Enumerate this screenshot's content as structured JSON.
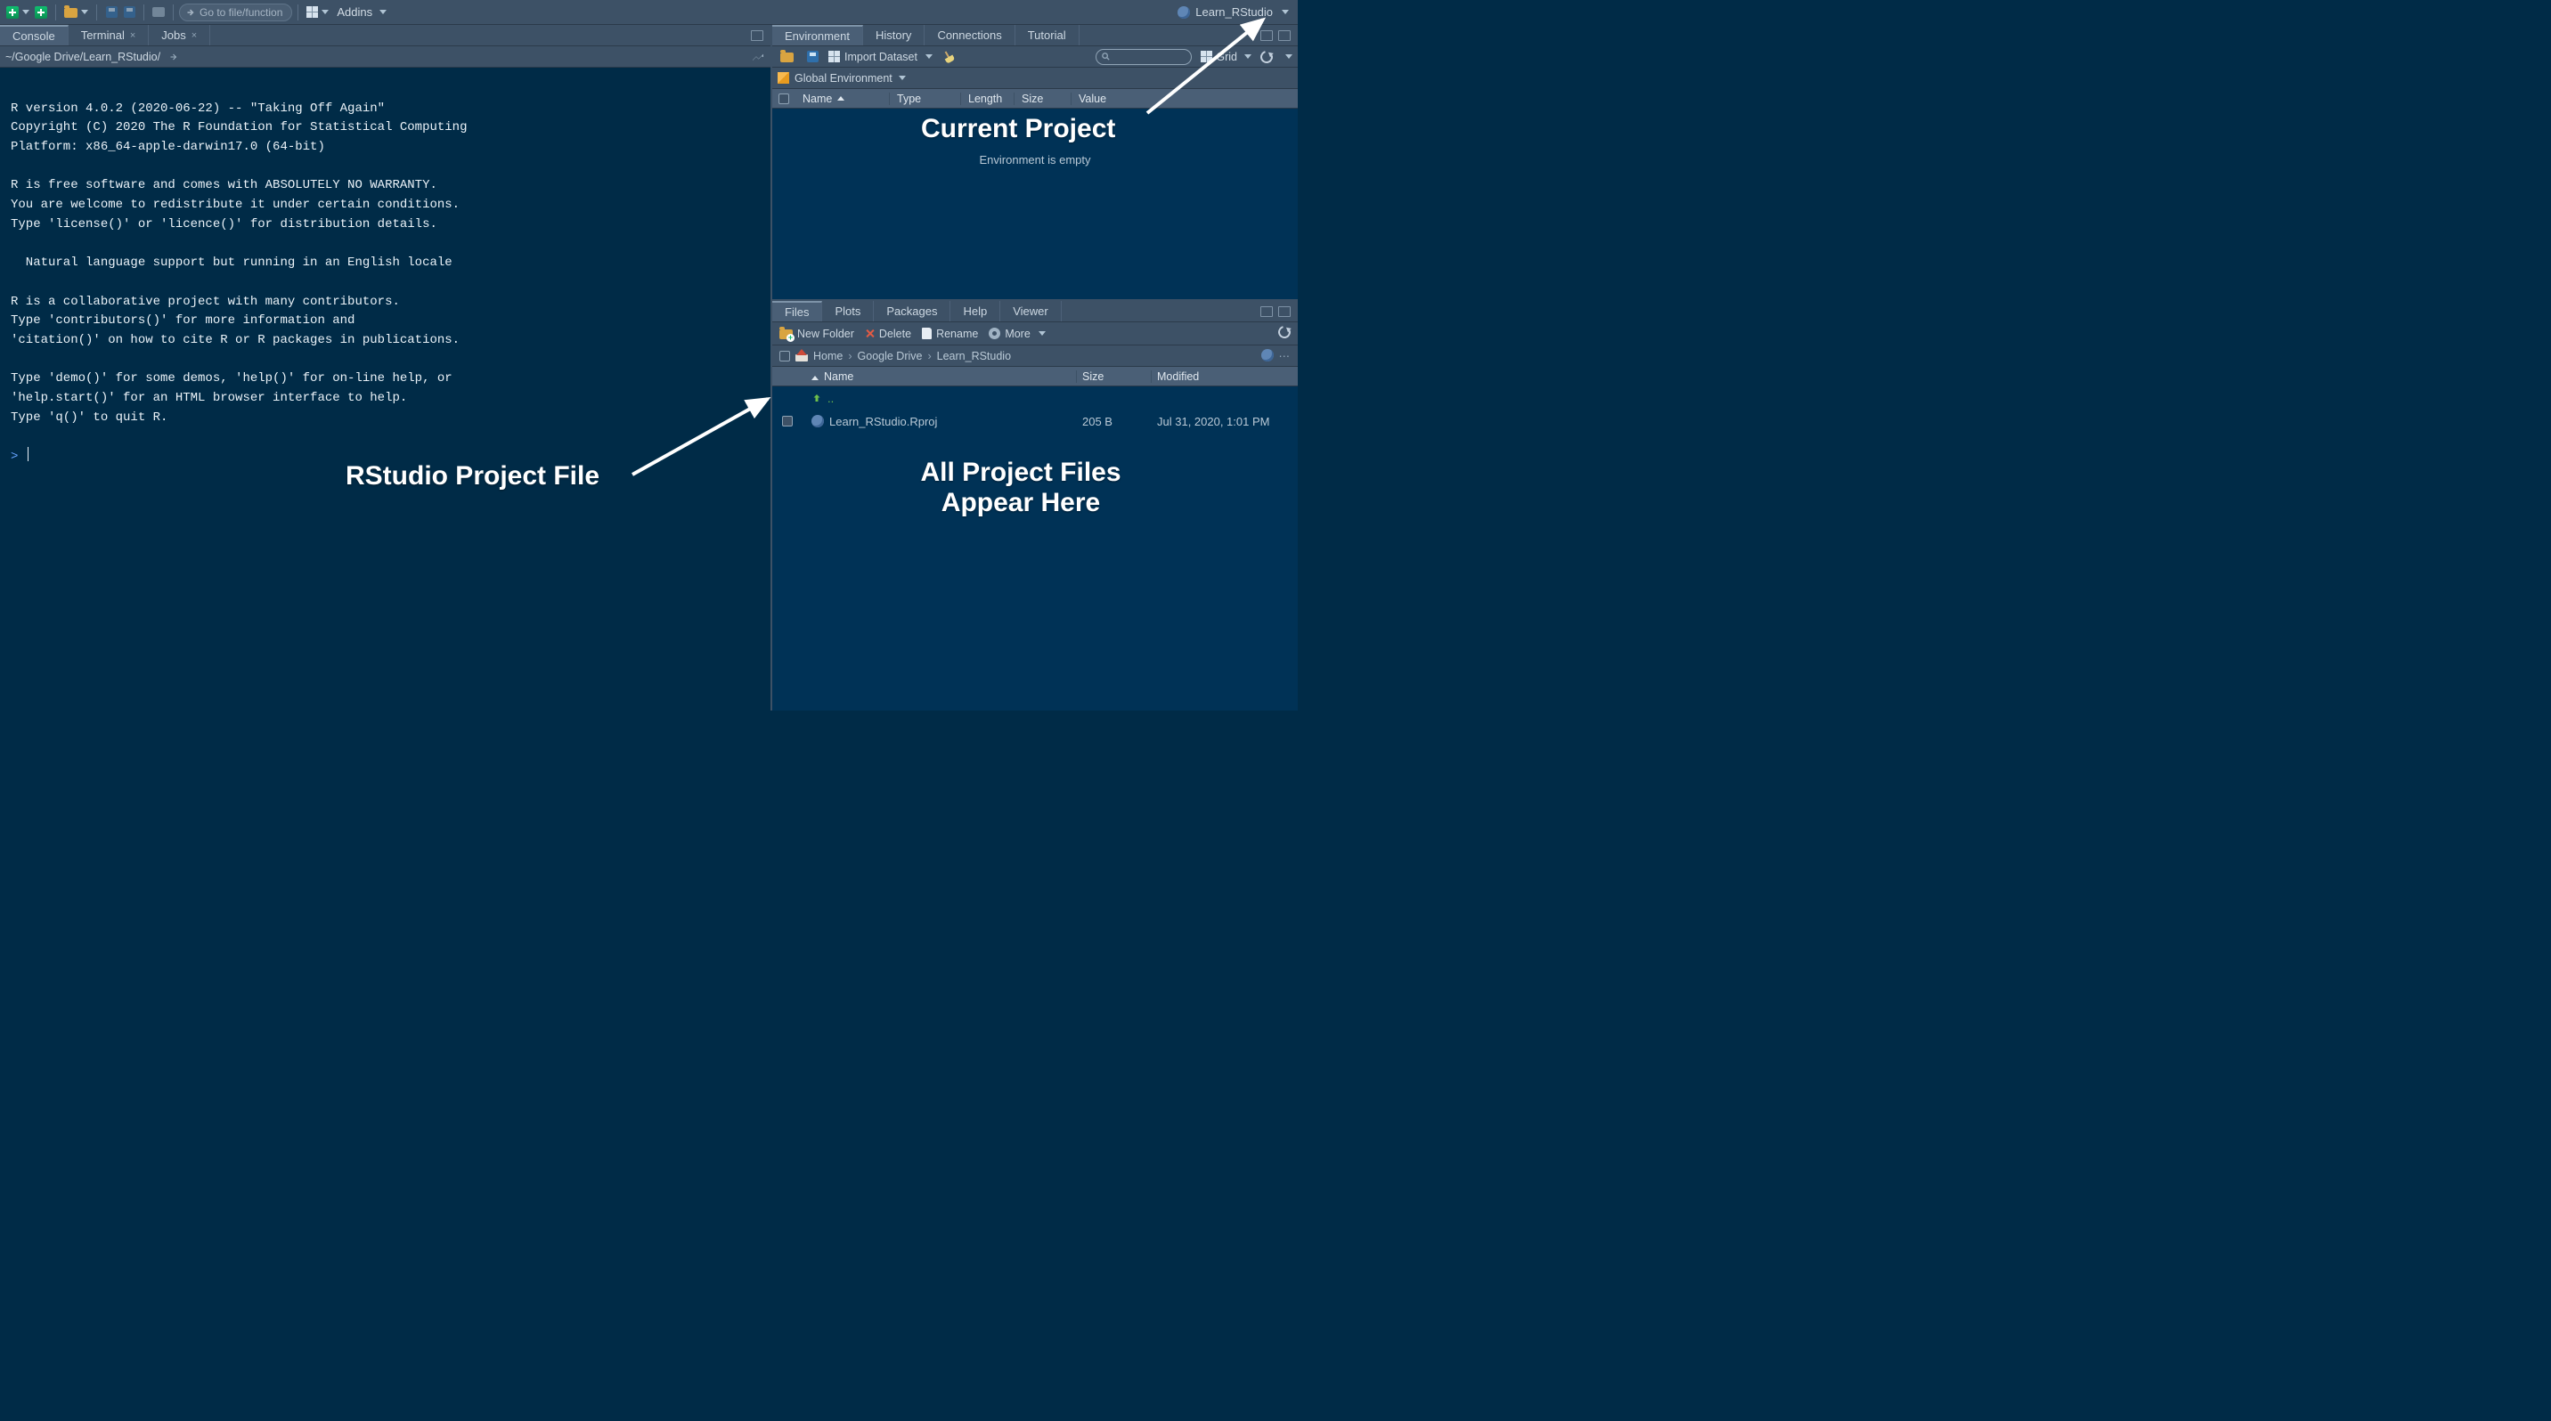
{
  "toolbar": {
    "goto_placeholder": "Go to file/function",
    "addins_label": "Addins",
    "project_name": "Learn_RStudio"
  },
  "console": {
    "tabs": {
      "console": "Console",
      "terminal": "Terminal",
      "jobs": "Jobs"
    },
    "path": "~/Google Drive/Learn_RStudio/",
    "body_lines": [
      "",
      "R version 4.0.2 (2020-06-22) -- \"Taking Off Again\"",
      "Copyright (C) 2020 The R Foundation for Statistical Computing",
      "Platform: x86_64-apple-darwin17.0 (64-bit)",
      "",
      "R is free software and comes with ABSOLUTELY NO WARRANTY.",
      "You are welcome to redistribute it under certain conditions.",
      "Type 'license()' or 'licence()' for distribution details.",
      "",
      "  Natural language support but running in an English locale",
      "",
      "R is a collaborative project with many contributors.",
      "Type 'contributors()' for more information and",
      "'citation()' on how to cite R or R packages in publications.",
      "",
      "Type 'demo()' for some demos, 'help()' for on-line help, or",
      "'help.start()' for an HTML browser interface to help.",
      "Type 'q()' to quit R.",
      ""
    ],
    "prompt": ">"
  },
  "environment": {
    "tabs": {
      "environment": "Environment",
      "history": "History",
      "connections": "Connections",
      "tutorial": "Tutorial"
    },
    "import_label": "Import Dataset",
    "scope_label": "Global Environment",
    "view_mode": "Grid",
    "cols": {
      "name": "Name",
      "type": "Type",
      "length": "Length",
      "size": "Size",
      "value": "Value"
    },
    "empty_text": "Environment is empty"
  },
  "files": {
    "tabs": {
      "files": "Files",
      "plots": "Plots",
      "packages": "Packages",
      "help": "Help",
      "viewer": "Viewer"
    },
    "newfolder_label": "New Folder",
    "delete_label": "Delete",
    "rename_label": "Rename",
    "more_label": "More",
    "breadcrumb": {
      "home": "Home",
      "p1": "Google Drive",
      "p2": "Learn_RStudio"
    },
    "cols": {
      "name": "Name",
      "size": "Size",
      "modified": "Modified"
    },
    "up_dir": "..",
    "rows": [
      {
        "name": "Learn_RStudio.Rproj",
        "size": "205 B",
        "modified": "Jul 31, 2020, 1:01 PM"
      }
    ]
  },
  "annotations": {
    "current_project": "Current Project",
    "project_file": "RStudio Project File",
    "appear_here_1": "All Project Files",
    "appear_here_2": "Appear Here"
  }
}
